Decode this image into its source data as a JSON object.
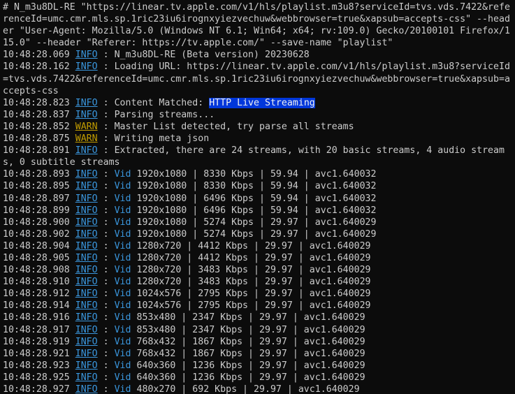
{
  "colors": {
    "background": "#0c0c0c",
    "text": "#cccccc",
    "info": "#3a96dd",
    "warn": "#c19c00",
    "highlight_bg": "#0037da"
  },
  "header_lines": [
    "# N_m3u8DL-RE \"https://linear.tv.apple.com/v1/hls/playlist.m3u8?serviceId=tvs.vds.7422&referenceId=umc.cmr.mls.sp.1ric23iu6irognxyiezvechuw&webbrowser=true&xapsub=accepts-css\" --header \"User-Agent: Mozilla/5.0 (Windows NT 6.1; Win64; x64; rv:109.0) Gecko/20100101 Firefox/115.0\" --header \"Referer: https://tv.apple.com/\" --save-name \"playlist\""
  ],
  "log_lines": [
    {
      "time": "10:48:28.069",
      "level": "INFO",
      "pre": "N_m3u8DL-RE (Beta version) 20230628",
      "hl": "",
      "post": "",
      "vid": ""
    },
    {
      "time": "10:48:28.162",
      "level": "INFO",
      "pre": "Loading URL: https://linear.tv.apple.com/v1/hls/playlist.m3u8?serviceId=tvs.vds.7422&referenceId=umc.cmr.mls.sp.1ric23iu6irognxyiezvechuw&webbrowser=true&xapsub=accepts-css",
      "hl": "",
      "post": "",
      "vid": ""
    },
    {
      "time": "10:48:28.823",
      "level": "INFO",
      "pre": "Content Matched: ",
      "hl": "HTTP Live Streaming",
      "post": "",
      "vid": ""
    },
    {
      "time": "10:48:28.837",
      "level": "INFO",
      "pre": "Parsing streams...",
      "hl": "",
      "post": "",
      "vid": ""
    },
    {
      "time": "10:48:28.852",
      "level": "WARN",
      "pre": "Master List detected, try parse all streams",
      "hl": "",
      "post": "",
      "vid": ""
    },
    {
      "time": "10:48:28.875",
      "level": "WARN",
      "pre": "Writing meta json",
      "hl": "",
      "post": "",
      "vid": ""
    },
    {
      "time": "10:48:28.891",
      "level": "INFO",
      "pre": "Extracted, there are 24 streams, with 20 basic streams, 4 audio streams, 0 subtitle streams",
      "hl": "",
      "post": "",
      "vid": ""
    },
    {
      "time": "10:48:28.893",
      "level": "INFO",
      "pre": "",
      "hl": "",
      "post": " 1920x1080 | 8330 Kbps | 59.94 | avc1.640032",
      "vid": "Vid"
    },
    {
      "time": "10:48:28.895",
      "level": "INFO",
      "pre": "",
      "hl": "",
      "post": " 1920x1080 | 8330 Kbps | 59.94 | avc1.640032",
      "vid": "Vid"
    },
    {
      "time": "10:48:28.897",
      "level": "INFO",
      "pre": "",
      "hl": "",
      "post": " 1920x1080 | 6496 Kbps | 59.94 | avc1.640032",
      "vid": "Vid"
    },
    {
      "time": "10:48:28.899",
      "level": "INFO",
      "pre": "",
      "hl": "",
      "post": " 1920x1080 | 6496 Kbps | 59.94 | avc1.640032",
      "vid": "Vid"
    },
    {
      "time": "10:48:28.900",
      "level": "INFO",
      "pre": "",
      "hl": "",
      "post": " 1920x1080 | 5274 Kbps | 29.97 | avc1.640029",
      "vid": "Vid"
    },
    {
      "time": "10:48:28.902",
      "level": "INFO",
      "pre": "",
      "hl": "",
      "post": " 1920x1080 | 5274 Kbps | 29.97 | avc1.640029",
      "vid": "Vid"
    },
    {
      "time": "10:48:28.904",
      "level": "INFO",
      "pre": "",
      "hl": "",
      "post": " 1280x720 | 4412 Kbps | 29.97 | avc1.640029",
      "vid": "Vid"
    },
    {
      "time": "10:48:28.905",
      "level": "INFO",
      "pre": "",
      "hl": "",
      "post": " 1280x720 | 4412 Kbps | 29.97 | avc1.640029",
      "vid": "Vid"
    },
    {
      "time": "10:48:28.908",
      "level": "INFO",
      "pre": "",
      "hl": "",
      "post": " 1280x720 | 3483 Kbps | 29.97 | avc1.640029",
      "vid": "Vid"
    },
    {
      "time": "10:48:28.910",
      "level": "INFO",
      "pre": "",
      "hl": "",
      "post": " 1280x720 | 3483 Kbps | 29.97 | avc1.640029",
      "vid": "Vid"
    },
    {
      "time": "10:48:28.912",
      "level": "INFO",
      "pre": "",
      "hl": "",
      "post": " 1024x576 | 2795 Kbps | 29.97 | avc1.640029",
      "vid": "Vid"
    },
    {
      "time": "10:48:28.914",
      "level": "INFO",
      "pre": "",
      "hl": "",
      "post": " 1024x576 | 2795 Kbps | 29.97 | avc1.640029",
      "vid": "Vid"
    },
    {
      "time": "10:48:28.916",
      "level": "INFO",
      "pre": "",
      "hl": "",
      "post": " 853x480 | 2347 Kbps | 29.97 | avc1.640029",
      "vid": "Vid"
    },
    {
      "time": "10:48:28.917",
      "level": "INFO",
      "pre": "",
      "hl": "",
      "post": " 853x480 | 2347 Kbps | 29.97 | avc1.640029",
      "vid": "Vid"
    },
    {
      "time": "10:48:28.919",
      "level": "INFO",
      "pre": "",
      "hl": "",
      "post": " 768x432 | 1867 Kbps | 29.97 | avc1.640029",
      "vid": "Vid"
    },
    {
      "time": "10:48:28.921",
      "level": "INFO",
      "pre": "",
      "hl": "",
      "post": " 768x432 | 1867 Kbps | 29.97 | avc1.640029",
      "vid": "Vid"
    },
    {
      "time": "10:48:28.923",
      "level": "INFO",
      "pre": "",
      "hl": "",
      "post": " 640x360 | 1236 Kbps | 29.97 | avc1.640029",
      "vid": "Vid"
    },
    {
      "time": "10:48:28.925",
      "level": "INFO",
      "pre": "",
      "hl": "",
      "post": " 640x360 | 1236 Kbps | 29.97 | avc1.640029",
      "vid": "Vid"
    },
    {
      "time": "10:48:28.927",
      "level": "INFO",
      "pre": "",
      "hl": "",
      "post": " 480x270 | 692 Kbps | 29.97 | avc1.640029",
      "vid": "Vid"
    }
  ]
}
